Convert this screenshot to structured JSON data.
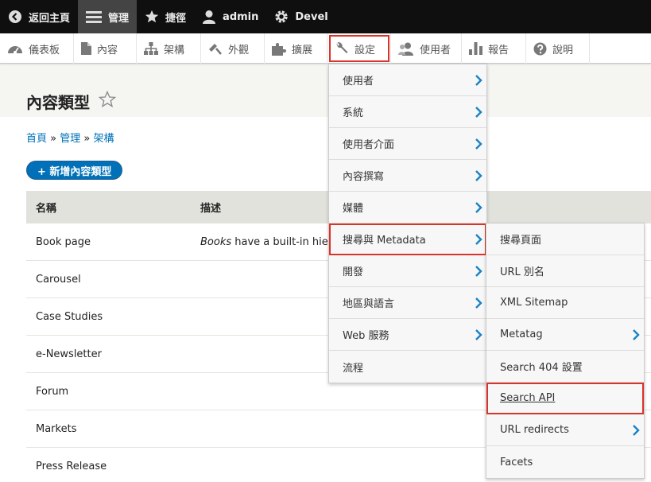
{
  "topbar": {
    "back": "返回主頁",
    "manage": "管理",
    "shortcuts": "捷徑",
    "user": "admin",
    "devel": "Devel"
  },
  "tray": {
    "items": [
      "儀表板",
      "內容",
      "架構",
      "外觀",
      "擴展",
      "設定",
      "使用者",
      "報告",
      "說明"
    ]
  },
  "page": {
    "title": "內容類型",
    "breadcrumb": [
      "首頁",
      "管理",
      "架構"
    ],
    "breadcrumb_sep": "»",
    "add_button": "+ 新增內容類型"
  },
  "table": {
    "headers": [
      "名稱",
      "描述"
    ],
    "rows": [
      {
        "name": "Book page",
        "desc_em": "Books",
        "desc": " have a built-in hier"
      },
      {
        "name": "Carousel",
        "desc_em": "",
        "desc": ""
      },
      {
        "name": "Case Studies",
        "desc_em": "",
        "desc": ""
      },
      {
        "name": "e-Newsletter",
        "desc_em": "",
        "desc": ""
      },
      {
        "name": "Forum",
        "desc_em": "",
        "desc": ""
      },
      {
        "name": "Markets",
        "desc_em": "",
        "desc": ""
      },
      {
        "name": "Press Release",
        "desc_em": "",
        "desc": ""
      }
    ]
  },
  "menu1": {
    "items": [
      "使用者",
      "系統",
      "使用者介面",
      "內容撰寫",
      "媒體",
      "搜尋與 Metadata",
      "開發",
      "地區與語言",
      "Web 服務",
      "流程"
    ]
  },
  "menu2": {
    "items": [
      "搜尋頁面",
      "URL 別名",
      "XML Sitemap",
      "Metatag",
      "Search 404 設置",
      "Search API",
      "URL redirects",
      "Facets"
    ]
  },
  "colors": {
    "accent": "#0071b8",
    "highlight": "#d9342b"
  }
}
